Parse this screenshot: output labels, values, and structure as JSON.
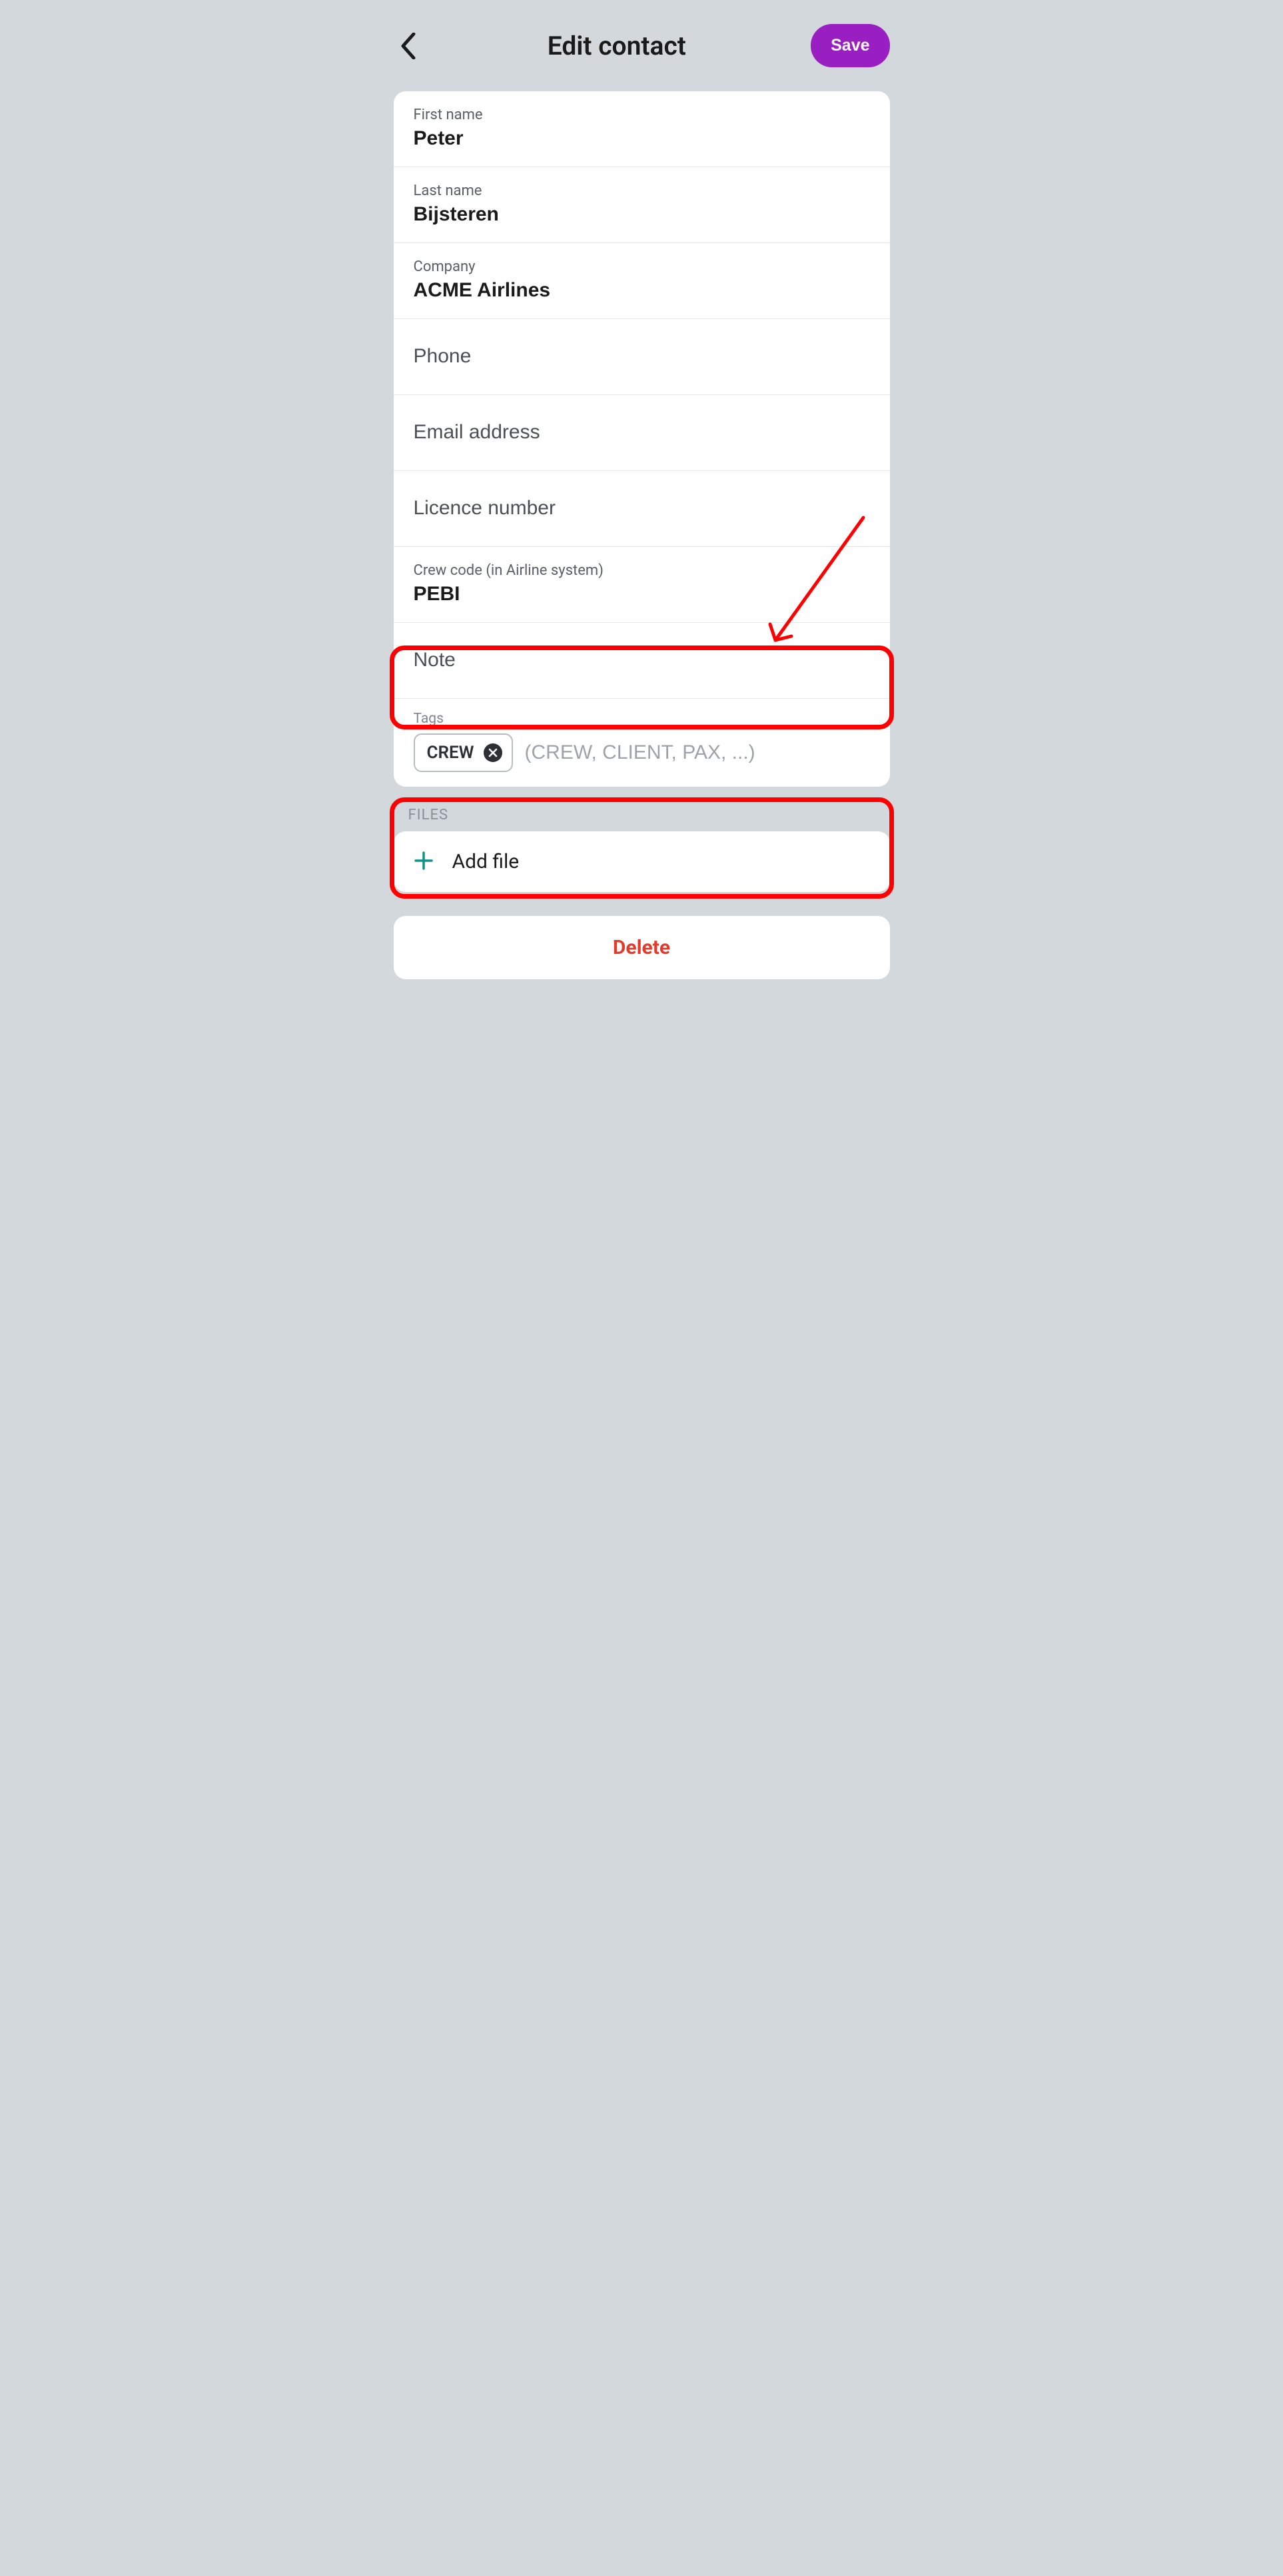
{
  "header": {
    "title": "Edit contact",
    "save_label": "Save"
  },
  "fields": {
    "first_name": {
      "label": "First name",
      "value": "Peter"
    },
    "last_name": {
      "label": "Last name",
      "value": "Bijsteren"
    },
    "company": {
      "label": "Company",
      "value": "ACME Airlines"
    },
    "phone": {
      "placeholder": "Phone",
      "value": ""
    },
    "email": {
      "placeholder": "Email address",
      "value": ""
    },
    "licence": {
      "placeholder": "Licence number",
      "value": ""
    },
    "crew_code": {
      "label": "Crew code (in Airline system)",
      "value": "PEBI"
    },
    "note": {
      "placeholder": "Note",
      "value": ""
    }
  },
  "tags": {
    "label": "Tags",
    "chips": [
      "CREW"
    ],
    "placeholder": "(CREW, CLIENT, PAX, ...)"
  },
  "files": {
    "section_label": "FILES",
    "add_label": "Add file"
  },
  "delete_label": "Delete",
  "annotation": {
    "highlights": [
      "crew_code_row",
      "tags_row"
    ],
    "arrow_target": "crew_code_row"
  },
  "colors": {
    "accent": "#9a1fc2",
    "danger": "#e23b2e",
    "highlight": "#ff0000",
    "teal": "#0d9488"
  }
}
